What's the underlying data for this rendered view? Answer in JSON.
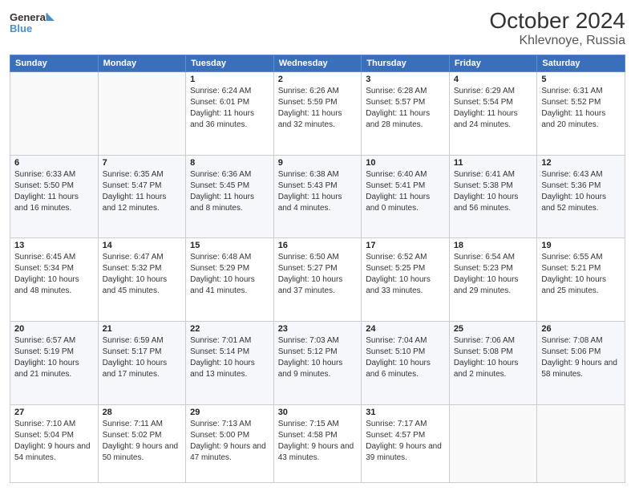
{
  "header": {
    "logo_line1": "General",
    "logo_line2": "Blue",
    "month": "October 2024",
    "location": "Khlevnoye, Russia"
  },
  "weekdays": [
    "Sunday",
    "Monday",
    "Tuesday",
    "Wednesday",
    "Thursday",
    "Friday",
    "Saturday"
  ],
  "weeks": [
    [
      {
        "day": "",
        "info": ""
      },
      {
        "day": "",
        "info": ""
      },
      {
        "day": "1",
        "info": "Sunrise: 6:24 AM\nSunset: 6:01 PM\nDaylight: 11 hours and 36 minutes."
      },
      {
        "day": "2",
        "info": "Sunrise: 6:26 AM\nSunset: 5:59 PM\nDaylight: 11 hours and 32 minutes."
      },
      {
        "day": "3",
        "info": "Sunrise: 6:28 AM\nSunset: 5:57 PM\nDaylight: 11 hours and 28 minutes."
      },
      {
        "day": "4",
        "info": "Sunrise: 6:29 AM\nSunset: 5:54 PM\nDaylight: 11 hours and 24 minutes."
      },
      {
        "day": "5",
        "info": "Sunrise: 6:31 AM\nSunset: 5:52 PM\nDaylight: 11 hours and 20 minutes."
      }
    ],
    [
      {
        "day": "6",
        "info": "Sunrise: 6:33 AM\nSunset: 5:50 PM\nDaylight: 11 hours and 16 minutes."
      },
      {
        "day": "7",
        "info": "Sunrise: 6:35 AM\nSunset: 5:47 PM\nDaylight: 11 hours and 12 minutes."
      },
      {
        "day": "8",
        "info": "Sunrise: 6:36 AM\nSunset: 5:45 PM\nDaylight: 11 hours and 8 minutes."
      },
      {
        "day": "9",
        "info": "Sunrise: 6:38 AM\nSunset: 5:43 PM\nDaylight: 11 hours and 4 minutes."
      },
      {
        "day": "10",
        "info": "Sunrise: 6:40 AM\nSunset: 5:41 PM\nDaylight: 11 hours and 0 minutes."
      },
      {
        "day": "11",
        "info": "Sunrise: 6:41 AM\nSunset: 5:38 PM\nDaylight: 10 hours and 56 minutes."
      },
      {
        "day": "12",
        "info": "Sunrise: 6:43 AM\nSunset: 5:36 PM\nDaylight: 10 hours and 52 minutes."
      }
    ],
    [
      {
        "day": "13",
        "info": "Sunrise: 6:45 AM\nSunset: 5:34 PM\nDaylight: 10 hours and 48 minutes."
      },
      {
        "day": "14",
        "info": "Sunrise: 6:47 AM\nSunset: 5:32 PM\nDaylight: 10 hours and 45 minutes."
      },
      {
        "day": "15",
        "info": "Sunrise: 6:48 AM\nSunset: 5:29 PM\nDaylight: 10 hours and 41 minutes."
      },
      {
        "day": "16",
        "info": "Sunrise: 6:50 AM\nSunset: 5:27 PM\nDaylight: 10 hours and 37 minutes."
      },
      {
        "day": "17",
        "info": "Sunrise: 6:52 AM\nSunset: 5:25 PM\nDaylight: 10 hours and 33 minutes."
      },
      {
        "day": "18",
        "info": "Sunrise: 6:54 AM\nSunset: 5:23 PM\nDaylight: 10 hours and 29 minutes."
      },
      {
        "day": "19",
        "info": "Sunrise: 6:55 AM\nSunset: 5:21 PM\nDaylight: 10 hours and 25 minutes."
      }
    ],
    [
      {
        "day": "20",
        "info": "Sunrise: 6:57 AM\nSunset: 5:19 PM\nDaylight: 10 hours and 21 minutes."
      },
      {
        "day": "21",
        "info": "Sunrise: 6:59 AM\nSunset: 5:17 PM\nDaylight: 10 hours and 17 minutes."
      },
      {
        "day": "22",
        "info": "Sunrise: 7:01 AM\nSunset: 5:14 PM\nDaylight: 10 hours and 13 minutes."
      },
      {
        "day": "23",
        "info": "Sunrise: 7:03 AM\nSunset: 5:12 PM\nDaylight: 10 hours and 9 minutes."
      },
      {
        "day": "24",
        "info": "Sunrise: 7:04 AM\nSunset: 5:10 PM\nDaylight: 10 hours and 6 minutes."
      },
      {
        "day": "25",
        "info": "Sunrise: 7:06 AM\nSunset: 5:08 PM\nDaylight: 10 hours and 2 minutes."
      },
      {
        "day": "26",
        "info": "Sunrise: 7:08 AM\nSunset: 5:06 PM\nDaylight: 9 hours and 58 minutes."
      }
    ],
    [
      {
        "day": "27",
        "info": "Sunrise: 7:10 AM\nSunset: 5:04 PM\nDaylight: 9 hours and 54 minutes."
      },
      {
        "day": "28",
        "info": "Sunrise: 7:11 AM\nSunset: 5:02 PM\nDaylight: 9 hours and 50 minutes."
      },
      {
        "day": "29",
        "info": "Sunrise: 7:13 AM\nSunset: 5:00 PM\nDaylight: 9 hours and 47 minutes."
      },
      {
        "day": "30",
        "info": "Sunrise: 7:15 AM\nSunset: 4:58 PM\nDaylight: 9 hours and 43 minutes."
      },
      {
        "day": "31",
        "info": "Sunrise: 7:17 AM\nSunset: 4:57 PM\nDaylight: 9 hours and 39 minutes."
      },
      {
        "day": "",
        "info": ""
      },
      {
        "day": "",
        "info": ""
      }
    ]
  ]
}
